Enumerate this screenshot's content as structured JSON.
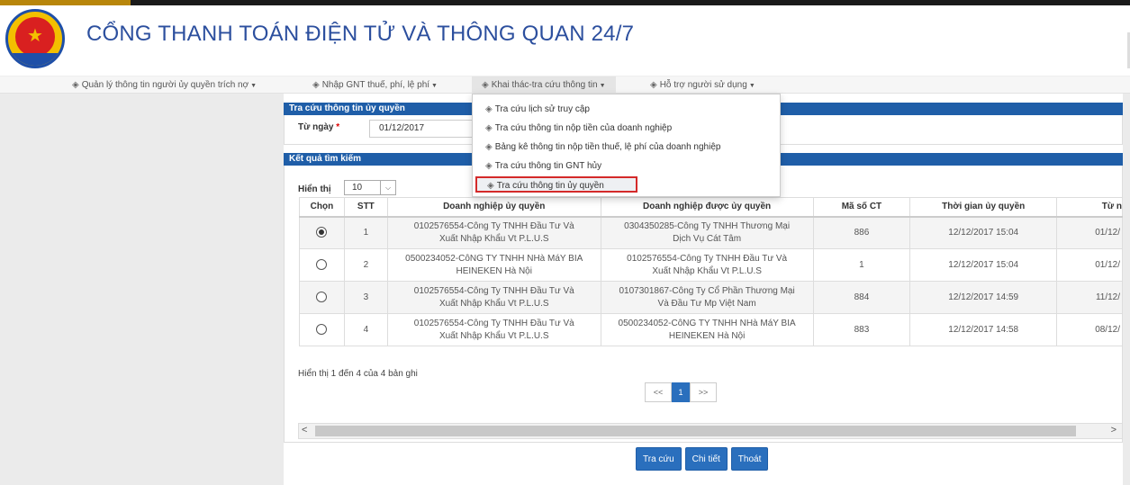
{
  "header": {
    "title": "CỔNG THANH TOÁN ĐIỆN TỬ VÀ THÔNG QUAN 24/7"
  },
  "nav": {
    "items": [
      {
        "label": "Quản lý thông tin người ủy quyền trích nợ",
        "icon": "gem-icon"
      },
      {
        "label": "Nhập GNT thuế, phí, lệ phí",
        "icon": "gem-icon"
      },
      {
        "label": "Khai thác-tra cứu thông tin",
        "icon": "gem-icon",
        "active": true
      },
      {
        "label": "Hỗ trợ người sử dụng",
        "icon": "gem-icon"
      }
    ]
  },
  "dropdown": {
    "items": [
      {
        "label": "Tra cứu lịch sử truy cập"
      },
      {
        "label": "Tra cứu thông tin nộp tiền của doanh nghiệp"
      },
      {
        "label": "Bảng kê thông tin nộp tiền thuế, lệ phí của doanh nghiệp"
      },
      {
        "label": "Tra cứu thông tin GNT hủy"
      },
      {
        "label": "Tra cứu thông tin ủy quyền",
        "highlighted": true
      }
    ]
  },
  "search_panel": {
    "title": "Tra cứu thông tin ủy quyền",
    "from_label": "Từ ngày",
    "required_mark": "*",
    "from_value": "01/12/2017"
  },
  "result_panel": {
    "title": "Kết quả tìm kiếm",
    "show_label": "Hiển thị",
    "page_size": "10"
  },
  "table": {
    "columns": [
      "Chọn",
      "STT",
      "Doanh nghiệp ủy quyền",
      "Doanh nghiệp được ủy quyền",
      "Mã số CT",
      "Thời gian ủy quyền",
      "Từ n"
    ],
    "rows": [
      {
        "selected": true,
        "stt": "1",
        "from1": "0102576554-Công Ty TNHH Đầu Tư Và",
        "from2": "Xuất Nhập Khẩu Vt P.L.U.S",
        "to1": "0304350285-Công Ty TNHH Thương Mại",
        "to2": "Dịch Vụ Cát Tâm",
        "ma": "886",
        "time": "12/12/2017 15:04",
        "tu": "01/12/"
      },
      {
        "selected": false,
        "stt": "2",
        "from1": "0500234052-CôNG TY TNHH NHà MáY BIA",
        "from2": "HEINEKEN Hà Nội",
        "to1": "0102576554-Công Ty TNHH Đầu Tư Và",
        "to2": "Xuất Nhập Khẩu Vt P.L.U.S",
        "ma": "1",
        "time": "12/12/2017 15:04",
        "tu": "01/12/"
      },
      {
        "selected": false,
        "stt": "3",
        "from1": "0102576554-Công Ty TNHH Đầu Tư Và",
        "from2": "Xuất Nhập Khẩu Vt P.L.U.S",
        "to1": "0107301867-Công Ty Cổ Phần Thương Mại",
        "to2": "Và Đầu Tư Mp Việt Nam",
        "ma": "884",
        "time": "12/12/2017 14:59",
        "tu": "11/12/"
      },
      {
        "selected": false,
        "stt": "4",
        "from1": "0102576554-Công Ty TNHH Đầu Tư Và",
        "from2": "Xuất Nhập Khẩu Vt P.L.U.S",
        "to1": "0500234052-CôNG TY TNHH NHà MáY BIA",
        "to2": "HEINEKEN Hà Nội",
        "ma": "883",
        "time": "12/12/2017 14:58",
        "tu": "08/12/"
      }
    ]
  },
  "summary": "Hiển thị 1 đến 4 của 4 bản ghi",
  "pager": {
    "prev": "<<",
    "current": "1",
    "next": ">>"
  },
  "scroll": {
    "left": "<",
    "right": ">"
  },
  "buttons": {
    "search": "Tra cứu",
    "detail": "Chi tiết",
    "exit": "Thoát"
  },
  "colors": {
    "primary": "#1f5ea8",
    "title": "#2c4f9e",
    "highlight_border": "#d42a2a"
  }
}
